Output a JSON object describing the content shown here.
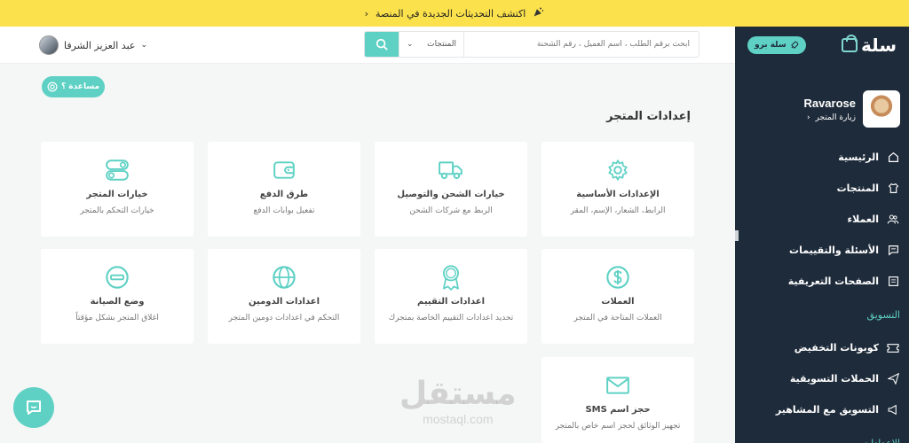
{
  "announcement": {
    "text": "اكتشف التحديثات الجديدة في المنصة"
  },
  "sidebar": {
    "logo_text": "سلة",
    "pro_label": "سلة برو",
    "store_name": "Ravarose",
    "visit_store": "زيارة المتجر",
    "items": [
      {
        "label": "الرئيسية",
        "icon": "home-icon"
      },
      {
        "label": "المنتجات",
        "icon": "shirt-icon"
      },
      {
        "label": "العملاء",
        "icon": "users-icon"
      },
      {
        "label": "الأسئلة والتقييمات",
        "icon": "chat-icon"
      },
      {
        "label": "الصفحات التعريفية",
        "icon": "pages-icon"
      }
    ],
    "section_marketing": "التسويق",
    "marketing_items": [
      {
        "label": "كوبونات التخفيض",
        "icon": "ticket-icon"
      },
      {
        "label": "الحملات التسويقية",
        "icon": "send-icon"
      },
      {
        "label": "التسويق مع المشاهير",
        "icon": "megaphone-icon"
      }
    ],
    "section_settings": "الإعدادات"
  },
  "header": {
    "user_name": "عبد العزيز الشرفا",
    "search_placeholder": "ابحث برقم الطلب ، اسم العميل ، رقم الشحنة",
    "search_scope": "المنتجات"
  },
  "main": {
    "help_label": "مساعدة ؟",
    "page_title": "إعدادات المتجر",
    "cards": [
      {
        "title": "الإعدادات الأساسية",
        "desc": "الرابط، الشعار، الإسم، المقر",
        "icon": "gear-icon"
      },
      {
        "title": "خيارات الشحن والتوصيل",
        "desc": "الربط مع شركات الشحن",
        "icon": "truck-icon"
      },
      {
        "title": "طرق الدفع",
        "desc": "تفعيل بوابات الدفع",
        "icon": "wallet-icon"
      },
      {
        "title": "خيارات المتجر",
        "desc": "خيارات التحكم بالمتجر",
        "icon": "toggles-icon"
      },
      {
        "title": "العملات",
        "desc": "العملات المتاحة في المتجر",
        "icon": "dollar-icon"
      },
      {
        "title": "اعدادات التقييم",
        "desc": "تحديد اعدادات التقييم الخاصة بمتجرك",
        "icon": "medal-icon"
      },
      {
        "title": "اعدادات الدومين",
        "desc": "التحكم في اعدادات دومين المتجر",
        "icon": "globe-icon"
      },
      {
        "title": "وضع الصيانة",
        "desc": "اغلاق المتجر بشكل مؤقتاً",
        "icon": "minus-circle-icon"
      },
      {
        "title": "حجز اسم SMS",
        "desc": "تجهيز الوثائق لحجز اسم خاص بالمتجر",
        "icon": "envelope-icon"
      }
    ]
  },
  "watermark": {
    "ar": "مستقل",
    "en": "mostaql.com"
  },
  "colors": {
    "accent": "#5ed1c4",
    "sidebar": "#1e2b3a",
    "banner": "#fbe14b"
  }
}
